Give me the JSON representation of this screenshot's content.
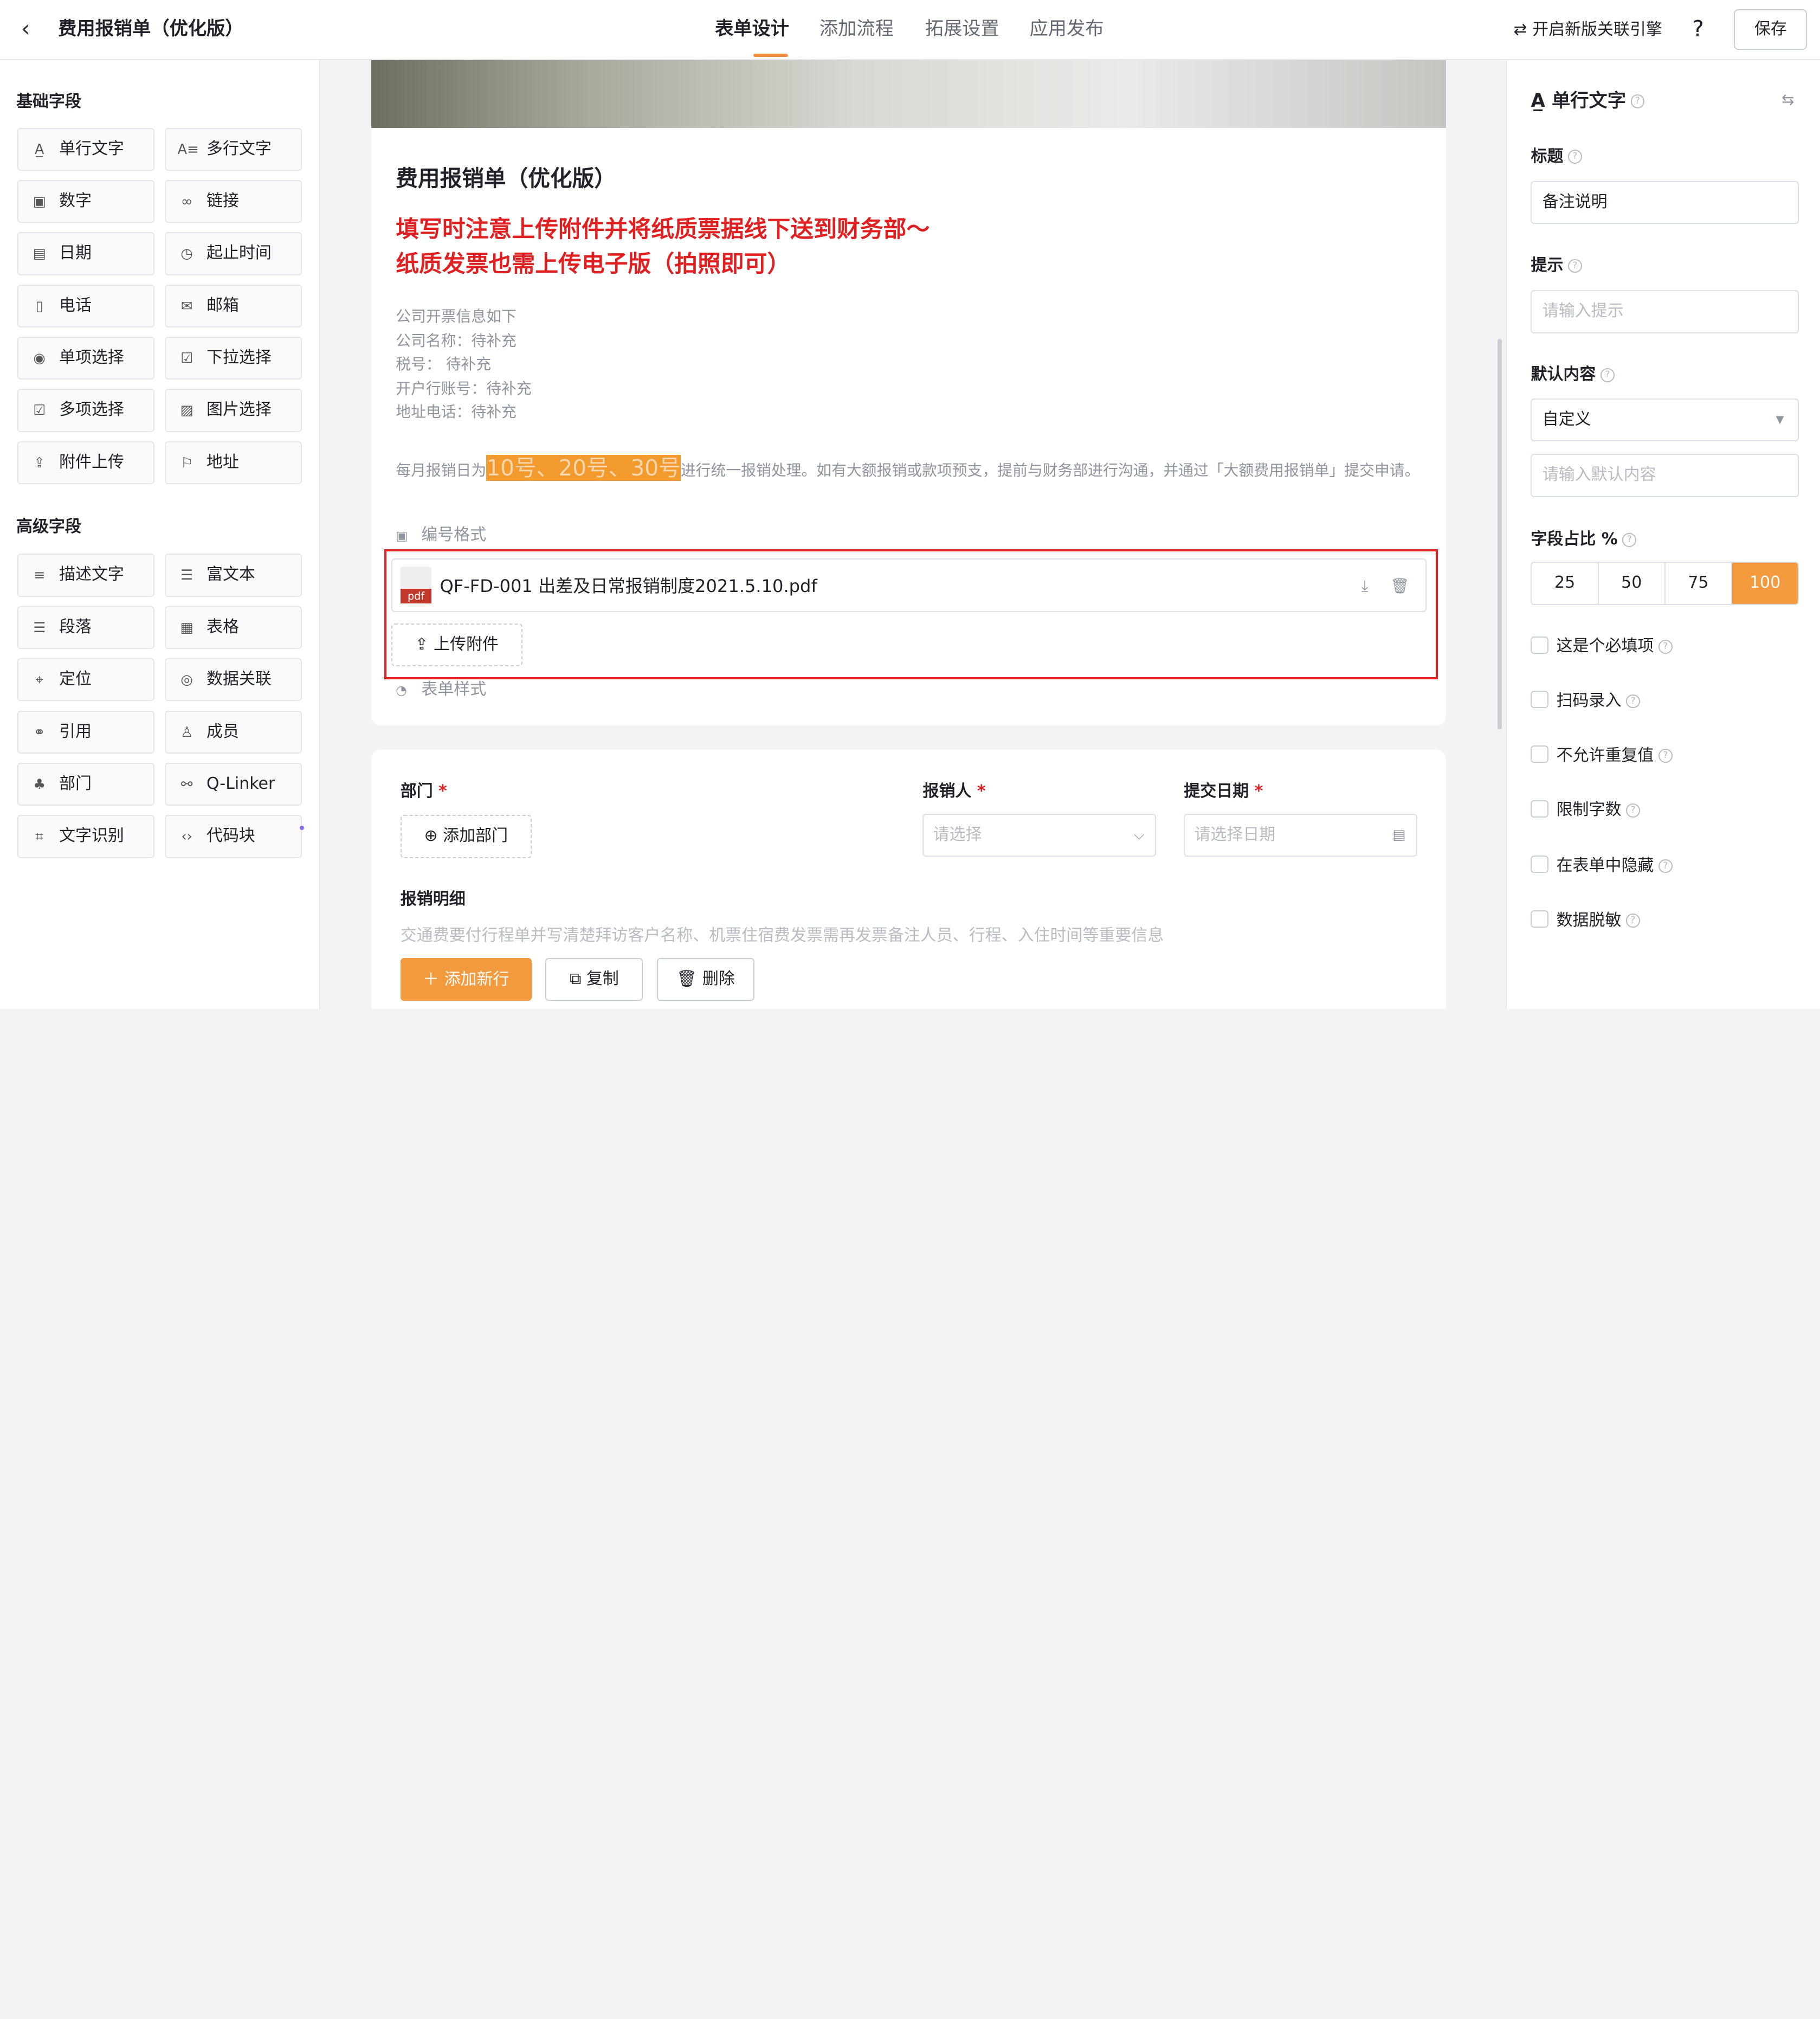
{
  "header": {
    "back_icon": "chevron-left-icon",
    "title": "费用报销单（优化版）",
    "tabs": [
      "表单设计",
      "添加流程",
      "拓展设置",
      "应用发布"
    ],
    "active_tab": "表单设计",
    "engine_link": "⇄ 开启新版关联引擎",
    "help_icon": "?",
    "save_label": "保存"
  },
  "palette": {
    "basic_title": "基础字段",
    "basic": [
      {
        "label": "单行文字",
        "icon": "A̲"
      },
      {
        "label": "多行文字",
        "icon": "A≡"
      },
      {
        "label": "数字",
        "icon": "▣"
      },
      {
        "label": "链接",
        "icon": "∞"
      },
      {
        "label": "日期",
        "icon": "▤"
      },
      {
        "label": "起止时间",
        "icon": "◷"
      },
      {
        "label": "电话",
        "icon": "▯"
      },
      {
        "label": "邮箱",
        "icon": "✉"
      },
      {
        "label": "单项选择",
        "icon": "◉"
      },
      {
        "label": "下拉选择",
        "icon": "☑"
      },
      {
        "label": "多项选择",
        "icon": "☑"
      },
      {
        "label": "图片选择",
        "icon": "▨"
      },
      {
        "label": "附件上传",
        "icon": "⇪"
      },
      {
        "label": "地址",
        "icon": "⚐"
      }
    ],
    "advanced_title": "高级字段",
    "advanced": [
      {
        "label": "描述文字",
        "icon": "≡"
      },
      {
        "label": "富文本",
        "icon": "☰"
      },
      {
        "label": "段落",
        "icon": "☰"
      },
      {
        "label": "表格",
        "icon": "▦"
      },
      {
        "label": "定位",
        "icon": "⌖"
      },
      {
        "label": "数据关联",
        "icon": "◎"
      },
      {
        "label": "引用",
        "icon": "⚭"
      },
      {
        "label": "成员",
        "icon": "♙"
      },
      {
        "label": "部门",
        "icon": "♣"
      },
      {
        "label": "Q-Linker",
        "icon": "⚯"
      },
      {
        "label": "文字识别",
        "icon": "⌗"
      },
      {
        "label": "代码块",
        "icon": "‹›"
      }
    ]
  },
  "form": {
    "title": "费用报销单（优化版）",
    "notice_line1": "填写时注意上传附件并将纸质票据线下送到财务部～",
    "notice_line2": "纸质发票也需上传电子版（拍照即可）",
    "company_info": [
      "公司开票信息如下",
      "公司名称：待补充",
      "税号：  待补充",
      "开户行账号：待补充",
      "地址电话：待补充"
    ],
    "para_before": "每月报销日为",
    "para_highlight": "10号、20号、30号",
    "para_after": "进行统一报销处理。如有大额报销或款项预支，提前与财务部进行沟通，并通过「大额费用报销单」提交申请。",
    "number_format": "编号格式",
    "attachment_name": "QF-FD-001 出差及日常报销制度2021.5.10.pdf",
    "pdf_badge": "pdf",
    "download_icon": "⤓",
    "delete_icon": "🗑",
    "upload_label": "上传附件",
    "form_style": "表单样式",
    "dept_label": "部门",
    "required_mark": "*",
    "add_dept_label": "添加部门",
    "reporter_label": "报销人",
    "reporter_placeholder": "请选择",
    "date_label": "提交日期",
    "date_placeholder": "请选择日期",
    "detail_label": "报销明细",
    "detail_desc": "交通费要付行程单并写清楚拜访客户名称、机票住宿费发票需再发票备注人员、行程、入住时间等重要信息",
    "add_row_label": "添加新行",
    "copy_label": "复制",
    "delete_label": "删除"
  },
  "props": {
    "field_type": "单行文字",
    "field_icon": "A̲",
    "title_label": "标题",
    "title_value": "备注说明",
    "hint_label": "提示",
    "hint_placeholder": "请输入提示",
    "default_label": "默认内容",
    "default_mode": "自定义",
    "default_placeholder": "请输入默认内容",
    "width_label": "字段占比 %",
    "width_options": [
      "25",
      "50",
      "75",
      "100"
    ],
    "width_selected": "100",
    "checks": [
      "这是个必填项",
      "扫码录入",
      "不允许重复值",
      "限制字数",
      "在表单中隐藏",
      "数据脱敏"
    ]
  },
  "colors": {
    "accent": "#f39a3e",
    "alert": "#e02020",
    "highlight": "#f39a2e"
  }
}
